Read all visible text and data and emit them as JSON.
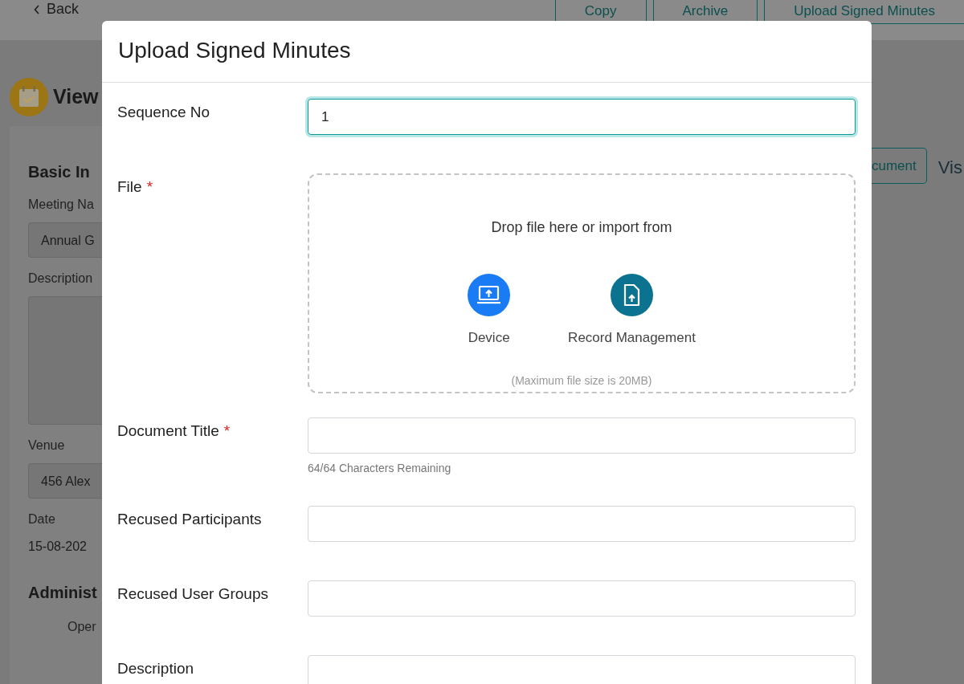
{
  "background": {
    "back_link": "Back",
    "actions": [
      {
        "label": "Copy"
      },
      {
        "label": "Archive"
      },
      {
        "label": "Upload Signed Minutes"
      }
    ],
    "page_title": "View",
    "section_title": "Basic In",
    "fields": [
      {
        "label": "Meeting Na",
        "value": "Annual G",
        "kind": "input"
      },
      {
        "label": "Description",
        "kind": "textarea"
      },
      {
        "label": "Venue",
        "value": "456 Alex",
        "kind": "input"
      },
      {
        "label": "Date",
        "value": "15-08-202",
        "kind": "text"
      }
    ],
    "section2_title": "Administ",
    "item": "Oper",
    "right_button": "cument",
    "right_text": "Vis"
  },
  "dialog": {
    "title": "Upload Signed Minutes",
    "fields": [
      {
        "label": "Sequence No",
        "kind": "input",
        "value": "1",
        "focused": true
      },
      {
        "label": "File",
        "required_mark": "*",
        "kind": "dropzone",
        "prompt": "Drop file here or import from",
        "sources": [
          {
            "label": "Device",
            "kind": "device"
          },
          {
            "label": "Record Management",
            "kind": "record"
          }
        ],
        "note": "(Maximum file size is 20MB)"
      },
      {
        "label": "Document Title",
        "required_mark": "*",
        "kind": "input",
        "focused": false,
        "helper": "64/64 Characters Remaining"
      },
      {
        "label": "Recused Participants",
        "kind": "input",
        "focused": false
      },
      {
        "label": "Recused User Groups",
        "kind": "input",
        "focused": false
      },
      {
        "label": "Description",
        "kind": "textarea",
        "focused": false
      }
    ]
  }
}
